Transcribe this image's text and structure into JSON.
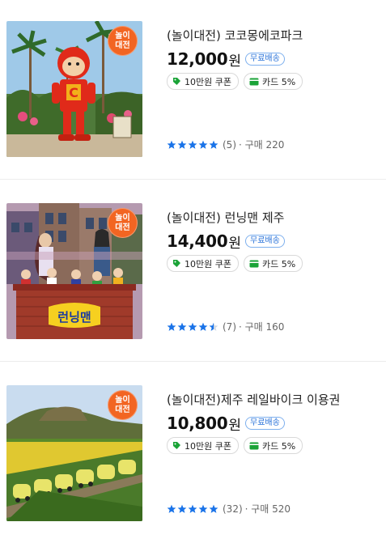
{
  "colors": {
    "badge": "#f26522",
    "star": "#1a73e8",
    "shipping": "#2a73d9",
    "coupon_icon": "#1aa337"
  },
  "products": [
    {
      "badge": "놀이\n대전",
      "title": "(놀이대전) 코코몽에코파크",
      "price": "12,000",
      "currency": "원",
      "shipping": "무료배송",
      "coupon": "10만원 쿠폰",
      "card": "카드 5%",
      "rating": 5,
      "review_count": "(5)",
      "sales": "· 구매 220",
      "image": "coco-mong-character-statue-with-palm-trees"
    },
    {
      "badge": "놀이\n대전",
      "title": "(놀이대전) 런닝맨 제주",
      "price": "14,400",
      "currency": "원",
      "shipping": "무료배송",
      "coupon": "10만원 쿠폰",
      "card": "카드 5%",
      "rating": 4.5,
      "review_count": "(7)",
      "sales": "· 구매 160",
      "image": "running-man-vr-set-with-brick-wall"
    },
    {
      "badge": "놀이\n대전",
      "title": "(놀이대전)제주 레일바이크 이용권",
      "price": "10,800",
      "currency": "원",
      "shipping": "무료배송",
      "coupon": "10만원 쿠폰",
      "card": "카드 5%",
      "rating": 5,
      "review_count": "(32)",
      "sales": "· 구매 520",
      "image": "rail-bikes-on-track-with-hill"
    }
  ]
}
